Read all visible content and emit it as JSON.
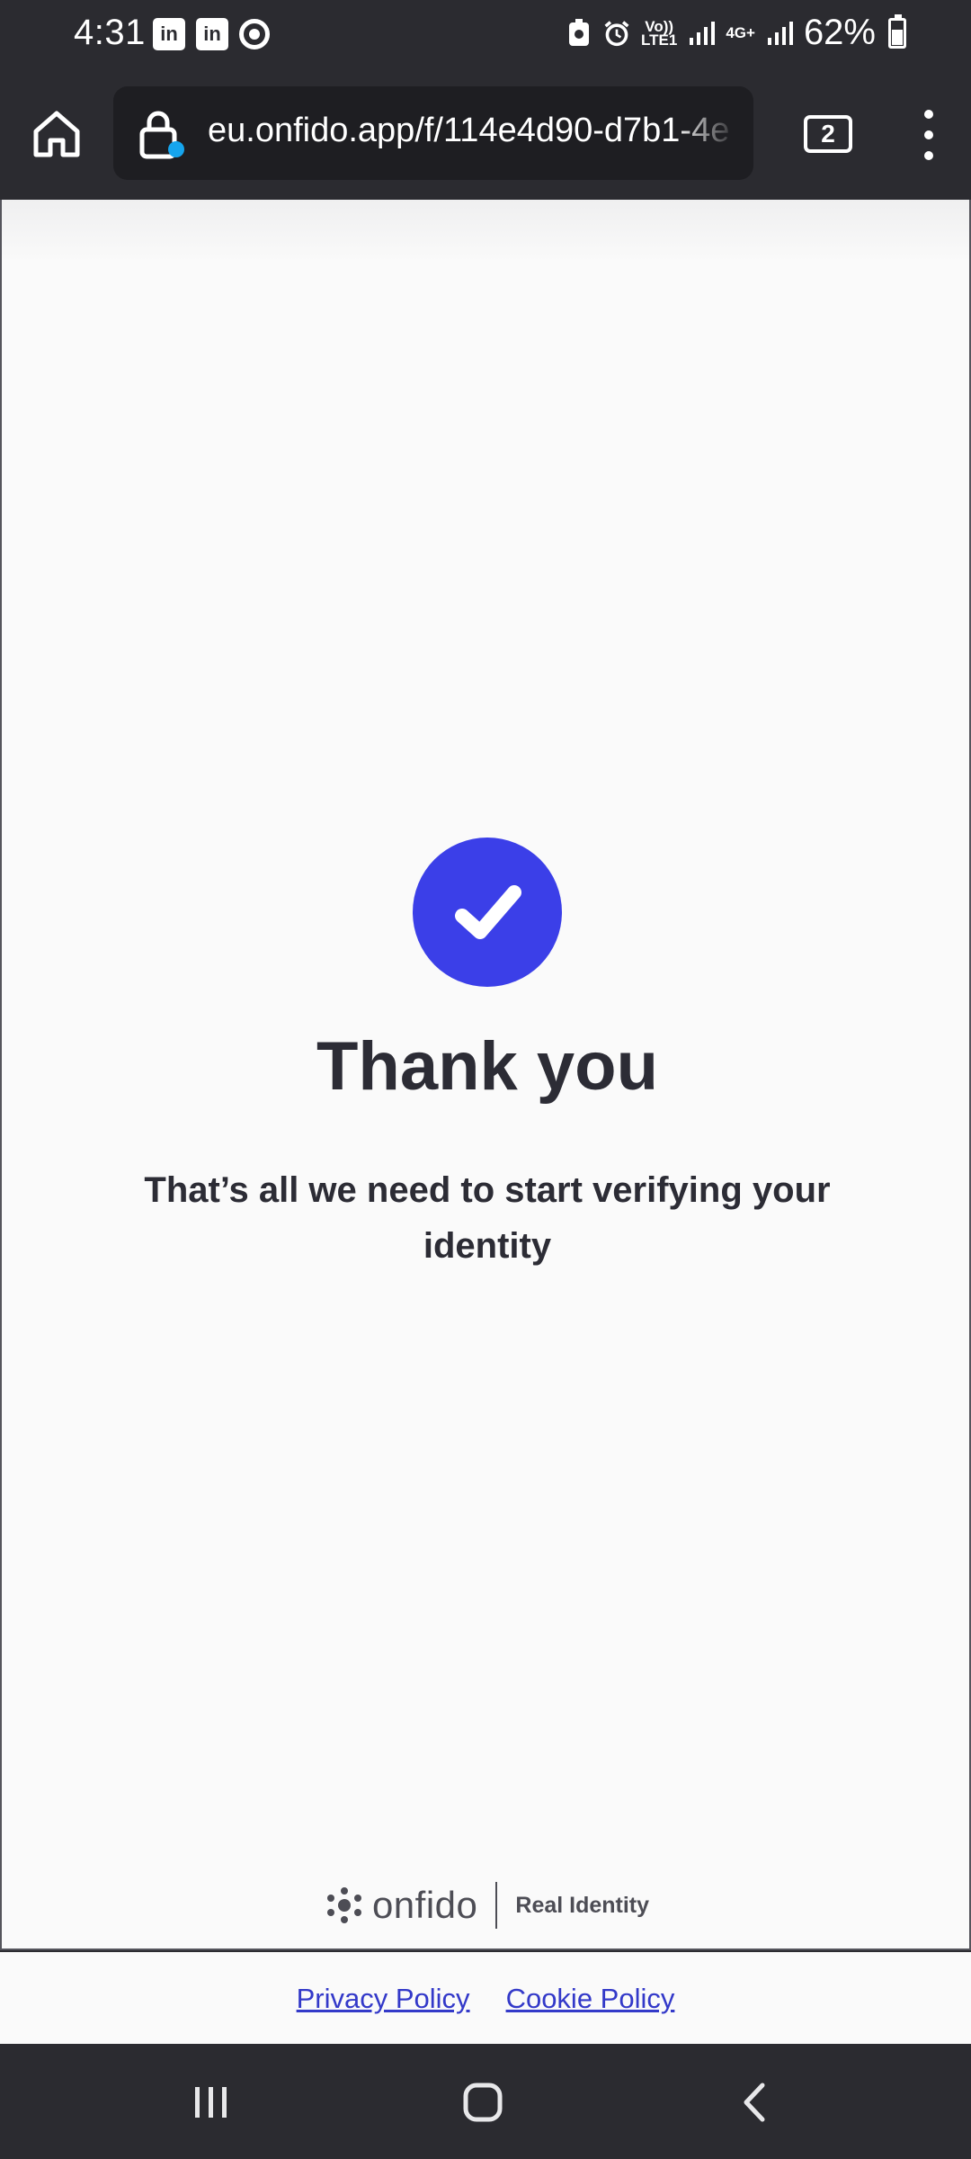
{
  "status_bar": {
    "time": "4:31",
    "network_label": "Vo))\nLTE1",
    "network2_label": "4G+",
    "battery": "62%",
    "battery_level": 0.62,
    "icons": [
      "linkedin-icon",
      "linkedin-icon",
      "chrome-icon",
      "nfc-icon",
      "alarm-icon",
      "volte-icon",
      "signal-icon",
      "4g-icon",
      "signal-icon",
      "battery-icon"
    ]
  },
  "browser": {
    "url": "eu.onfido.app/f/114e4d90-d7b1-4e",
    "tab_count": "2",
    "icons": [
      "home-icon",
      "lock-icon",
      "tabs-icon",
      "more-vert-icon"
    ]
  },
  "main": {
    "title": "Thank you",
    "message": "That’s all we need to start verifying your identity",
    "check_color": "#3b3fe8"
  },
  "footer": {
    "brand_name": "onfido",
    "brand_tagline": "Real Identity",
    "privacy_link": "Privacy Policy",
    "cookie_link": "Cookie Policy"
  },
  "nav": {
    "icons": [
      "recent-apps-icon",
      "home-nav-icon",
      "back-icon"
    ]
  }
}
